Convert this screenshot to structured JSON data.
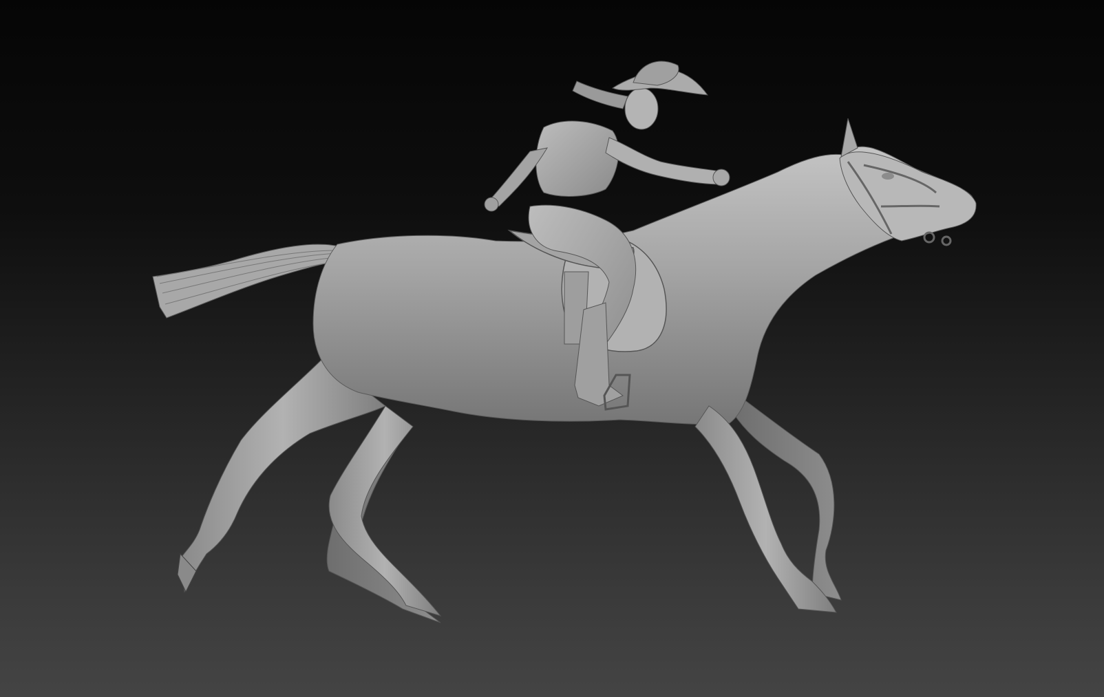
{
  "viewport": {
    "subject": "sculpt-horse-rider",
    "background": {
      "top": "#050505",
      "bottom": "#444444"
    },
    "material_color": "#9a9a9a"
  }
}
